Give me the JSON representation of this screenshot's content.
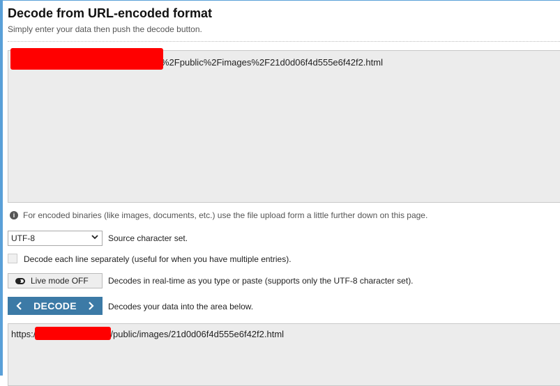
{
  "page": {
    "title": "Decode from URL-encoded format",
    "subtitle": "Simply enter your data then push the decode button."
  },
  "input": {
    "value_suffix": "%2Fpublic%2Fimages%2F21d0d06f4d555e6f42f2.html"
  },
  "info": {
    "icon": "info-icon",
    "text": "For encoded binaries (like images, documents, etc.) use the file upload form a little further down on this page."
  },
  "charset": {
    "selected": "UTF-8",
    "label": "Source character set."
  },
  "each_line": {
    "label": "Decode each line separately (useful for when you have multiple entries).",
    "checked": false
  },
  "live_mode": {
    "button_label": "Live mode OFF",
    "label": "Decodes in real-time as you type or paste (supports only the UTF-8 character set)."
  },
  "decode": {
    "button_label": "DECODE",
    "label": "Decodes your data into the area below."
  },
  "output": {
    "value_prefix": "https:/",
    "value_suffix": "/public/images/21d0d06f4d555e6f42f2.html"
  },
  "colors": {
    "accent": "#3c7aa6",
    "redaction": "#ff0000",
    "frame": "#5aa0d8"
  }
}
